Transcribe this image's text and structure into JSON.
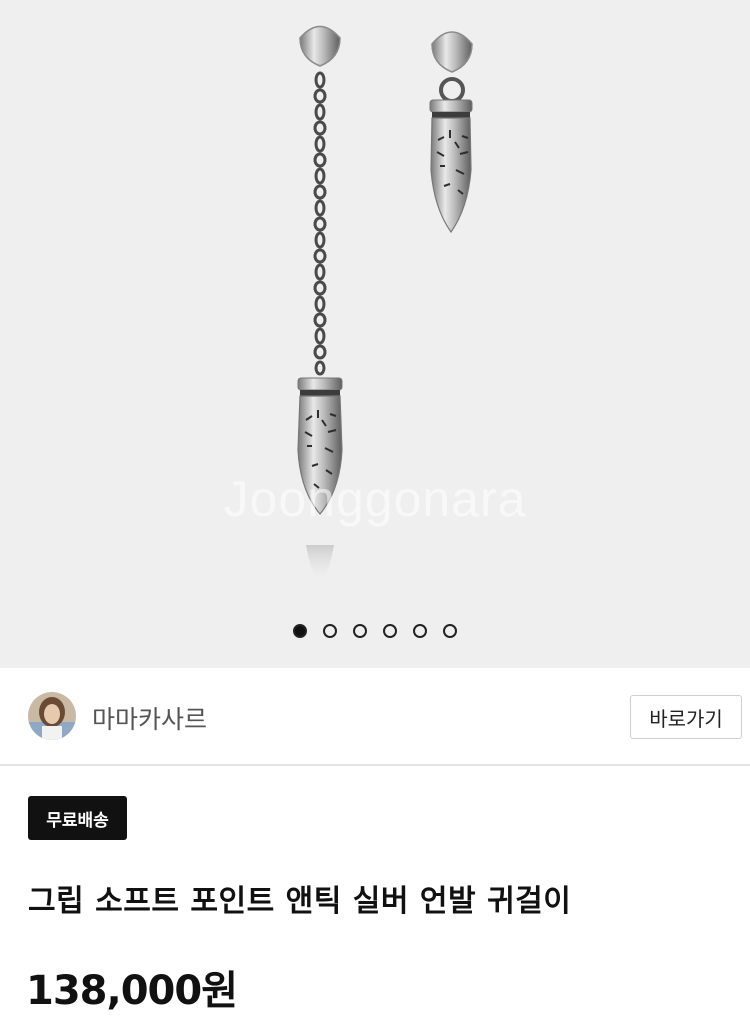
{
  "gallery": {
    "watermark": "Joonggonara",
    "image_label": "product-earring-image",
    "slide_count": 6,
    "active_slide": 1
  },
  "seller": {
    "name": "마마카사르",
    "visit_button": "바로가기"
  },
  "product": {
    "badge": "무료배송",
    "title": "그립 소프트 포인트 앤틱 실버 언발 귀걸이",
    "price": "138,000원"
  }
}
